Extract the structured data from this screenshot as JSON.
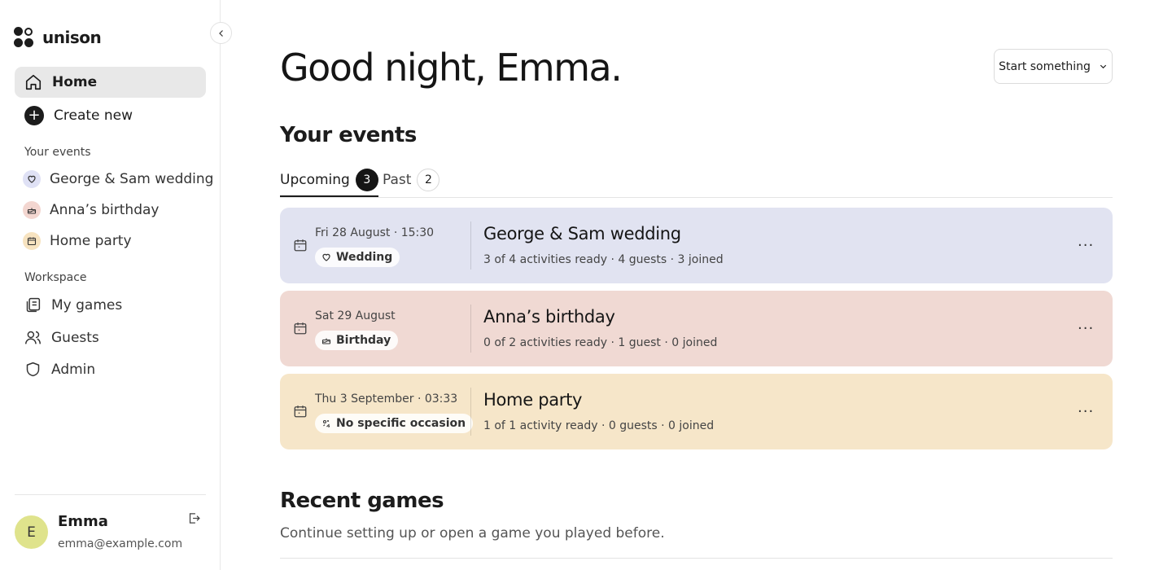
{
  "brand": {
    "name": "unison"
  },
  "sidebar": {
    "home_label": "Home",
    "create_label": "Create new",
    "your_events_title": "Your events",
    "events": [
      {
        "label": "George & Sam wedding",
        "icon": "heart-icon",
        "color": "#dfe1f5"
      },
      {
        "label": "Anna’s birthday",
        "icon": "cake-icon",
        "color": "#f3d6d0"
      },
      {
        "label": "Home party",
        "icon": "calendar-icon",
        "color": "#f7e3c0"
      }
    ],
    "workspace_title": "Workspace",
    "workspace": [
      {
        "label": "My games",
        "icon": "games-icon"
      },
      {
        "label": "Guests",
        "icon": "users-icon"
      },
      {
        "label": "Admin",
        "icon": "shield-icon"
      }
    ]
  },
  "user": {
    "initial": "E",
    "name": "Emma",
    "email": "emma@example.com"
  },
  "header": {
    "greeting": "Good night, Emma.",
    "start_label": "Start something"
  },
  "events_section": {
    "title": "Your events",
    "tabs": [
      {
        "label": "Upcoming",
        "count": "3",
        "active": true
      },
      {
        "label": "Past",
        "count": "2",
        "active": false
      }
    ],
    "cards": [
      {
        "date": "Fri 28 August · 15:30",
        "tag": "Wedding",
        "tag_icon": "heart-icon",
        "title": "George & Sam wedding",
        "meta": "3 of 4 activities ready · 4 guests · 3 joined",
        "bg": "#e1e3f1"
      },
      {
        "date": "Sat 29 August",
        "tag": "Birthday",
        "tag_icon": "cake-icon",
        "title": "Anna’s birthday",
        "meta": "0 of 2 activities ready · 1 guest · 0 joined",
        "bg": "#f0d9d3"
      },
      {
        "date": "Thu 3 September · 03:33",
        "tag": "No specific occasion",
        "tag_icon": "sparkle-icon",
        "title": "Home party",
        "meta": "1 of 1 activity ready · 0 guests · 0 joined",
        "bg": "#f6e6c9"
      }
    ],
    "more_glyph": "···"
  },
  "recent": {
    "title": "Recent games",
    "subtitle": "Continue setting up or open a game you played before."
  }
}
